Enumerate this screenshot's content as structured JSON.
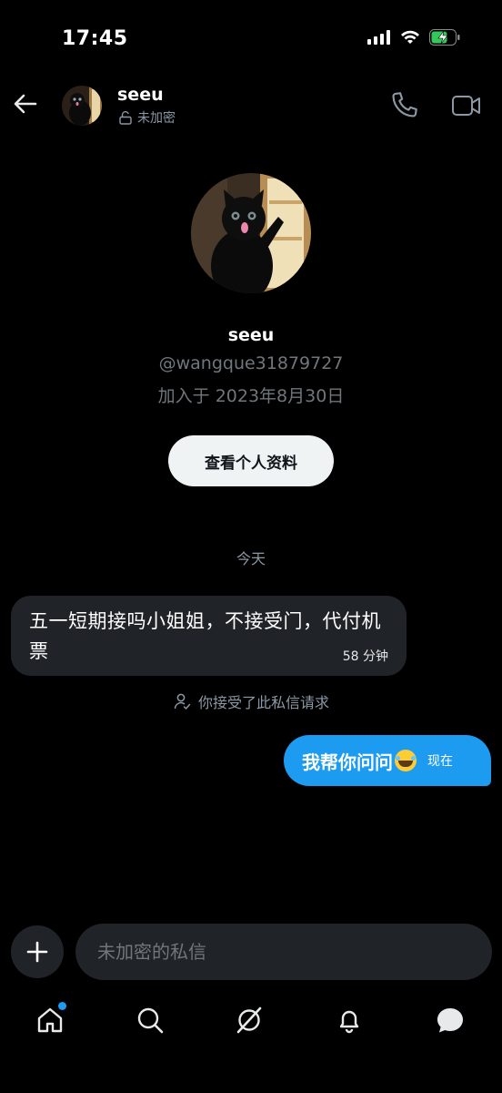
{
  "status_bar": {
    "time": "17:45"
  },
  "header": {
    "name": "seeu",
    "encryption_status": "未加密"
  },
  "profile": {
    "name": "seeu",
    "handle": "@wangque31879727",
    "joined": "加入于 2023年8月30日",
    "view_profile_label": "查看个人资料"
  },
  "conversation": {
    "date_separator": "今天",
    "messages": [
      {
        "direction": "incoming",
        "text": "五一短期接吗小姐姐，不接受门，代付机票",
        "time": "58 分钟"
      },
      {
        "direction": "outgoing",
        "text": "我帮你问问",
        "emoji": "grinning-face-with-sweat",
        "time": "现在"
      }
    ],
    "accepted_note": "你接受了此私信请求"
  },
  "composer": {
    "placeholder": "未加密的私信"
  },
  "nav": {
    "items": [
      "home",
      "search",
      "grok",
      "notifications",
      "messages"
    ],
    "home_has_badge": true
  },
  "colors": {
    "accent": "#1d9bf0",
    "bubble_in": "#202327",
    "background": "#000000"
  }
}
